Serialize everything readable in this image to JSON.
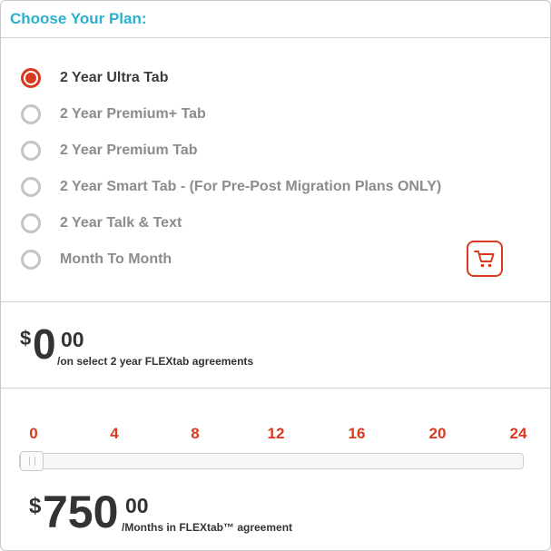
{
  "header": {
    "title": "Choose Your Plan:"
  },
  "plans": [
    {
      "label": "2 Year Ultra Tab",
      "selected": true
    },
    {
      "label": "2 Year Premium+ Tab",
      "selected": false
    },
    {
      "label": "2 Year Premium Tab",
      "selected": false
    },
    {
      "label": "2 Year Smart Tab - (For Pre-Post Migration Plans ONLY)",
      "selected": false
    },
    {
      "label": "2 Year Talk & Text",
      "selected": false
    },
    {
      "label": "Month To Month",
      "selected": false
    }
  ],
  "cart": {
    "icon": "shopping-cart-icon"
  },
  "upfront_price": {
    "currency": "$",
    "amount": "0",
    "cents": "00",
    "note": "/on select 2 year FLEXtab agreements"
  },
  "months_slider": {
    "ticks": [
      "0",
      "4",
      "8",
      "12",
      "16",
      "20",
      "24"
    ],
    "min": 0,
    "max": 24,
    "value": 0
  },
  "flex_price": {
    "currency": "$",
    "amount": "750",
    "cents": "00",
    "note": "/Months in FLEXtab™ agreement"
  },
  "colors": {
    "accent": "#d9391e",
    "header_title": "#2bb1cf",
    "unselected_text": "#8c8c8c",
    "selected_text": "#3c3c3c"
  }
}
